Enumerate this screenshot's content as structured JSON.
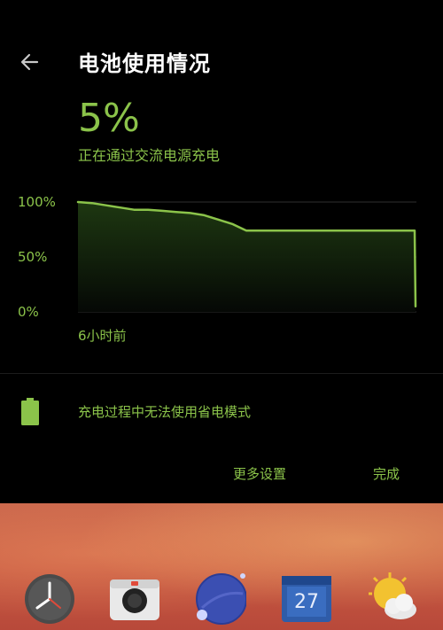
{
  "header": {
    "back_icon": "arrow-left-icon",
    "title": "电池使用情况"
  },
  "battery": {
    "percent_text": "5%",
    "status_text": "正在通过交流电源充电",
    "icon": "battery-charging-icon",
    "accent_color": "#8bc34a"
  },
  "chart_data": {
    "type": "area",
    "y_tick_labels": [
      "100%",
      "50%",
      "0%"
    ],
    "ylim": [
      0,
      100
    ],
    "x_label": "6小时前",
    "grid": true,
    "series": [
      {
        "values": [
          100,
          99,
          97,
          95,
          93,
          93,
          92,
          91,
          90,
          88,
          84,
          80,
          74,
          74,
          74,
          74,
          74,
          74,
          74,
          74,
          74,
          74,
          74,
          74,
          74,
          5
        ]
      }
    ]
  },
  "power_save": {
    "note": "充电过程中无法使用省电模式"
  },
  "actions": {
    "more_settings": "更多设置",
    "done": "完成"
  },
  "dock": {
    "apps": [
      {
        "icon": "clock-icon"
      },
      {
        "icon": "camera-icon"
      },
      {
        "icon": "planet-icon"
      },
      {
        "icon": "calendar-icon",
        "label": "27"
      },
      {
        "icon": "weather-icon"
      }
    ]
  }
}
